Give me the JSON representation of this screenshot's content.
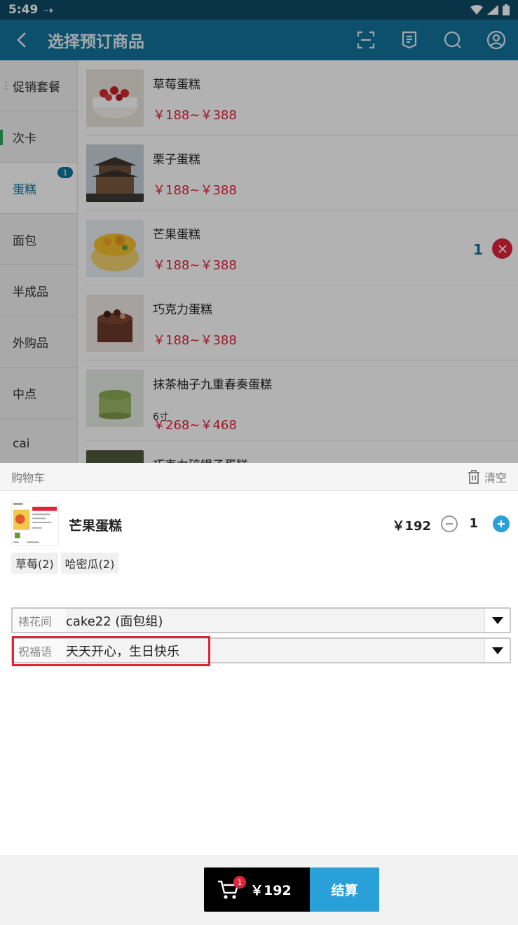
{
  "status_bar": {
    "time": "5:49"
  },
  "header": {
    "title": "选择预订商品"
  },
  "sidebar": {
    "items": [
      {
        "label": "促销套餐"
      },
      {
        "label": "次卡"
      },
      {
        "label": "蛋糕",
        "badge": "1"
      },
      {
        "label": "面包"
      },
      {
        "label": "半成品"
      },
      {
        "label": "外购品"
      },
      {
        "label": "中点"
      },
      {
        "label": "cai"
      }
    ]
  },
  "products": [
    {
      "name": "草莓蛋糕",
      "price": "￥188~￥388"
    },
    {
      "name": "栗子蛋糕",
      "price": "￥188~￥388"
    },
    {
      "name": "芒果蛋糕",
      "price": "￥188~￥388",
      "qty": "1"
    },
    {
      "name": "巧克力蛋糕",
      "price": "￥188~￥388"
    },
    {
      "name": "抹茶柚子九重春奏蛋糕",
      "spec": "6寸",
      "price": "￥268~￥468"
    },
    {
      "name": "巧克力碎银子蛋糕"
    }
  ],
  "cart": {
    "title": "购物车",
    "clear_label": "清空",
    "item": {
      "name": "芒果蛋糕",
      "price": "￥192",
      "qty": "1",
      "tags": [
        "草莓(2)",
        "哈密瓜(2)"
      ],
      "field1_label": "裱花间",
      "field1_value": "cake22 (面包组)",
      "field2_label": "祝福语",
      "field2_value": "天天开心，生日快乐"
    }
  },
  "footer": {
    "cart_badge": "1",
    "total": "￥192",
    "checkout_label": "结算"
  },
  "colors": {
    "primary": "#13739e",
    "accent": "#29a0d8",
    "price": "#e0243c"
  }
}
